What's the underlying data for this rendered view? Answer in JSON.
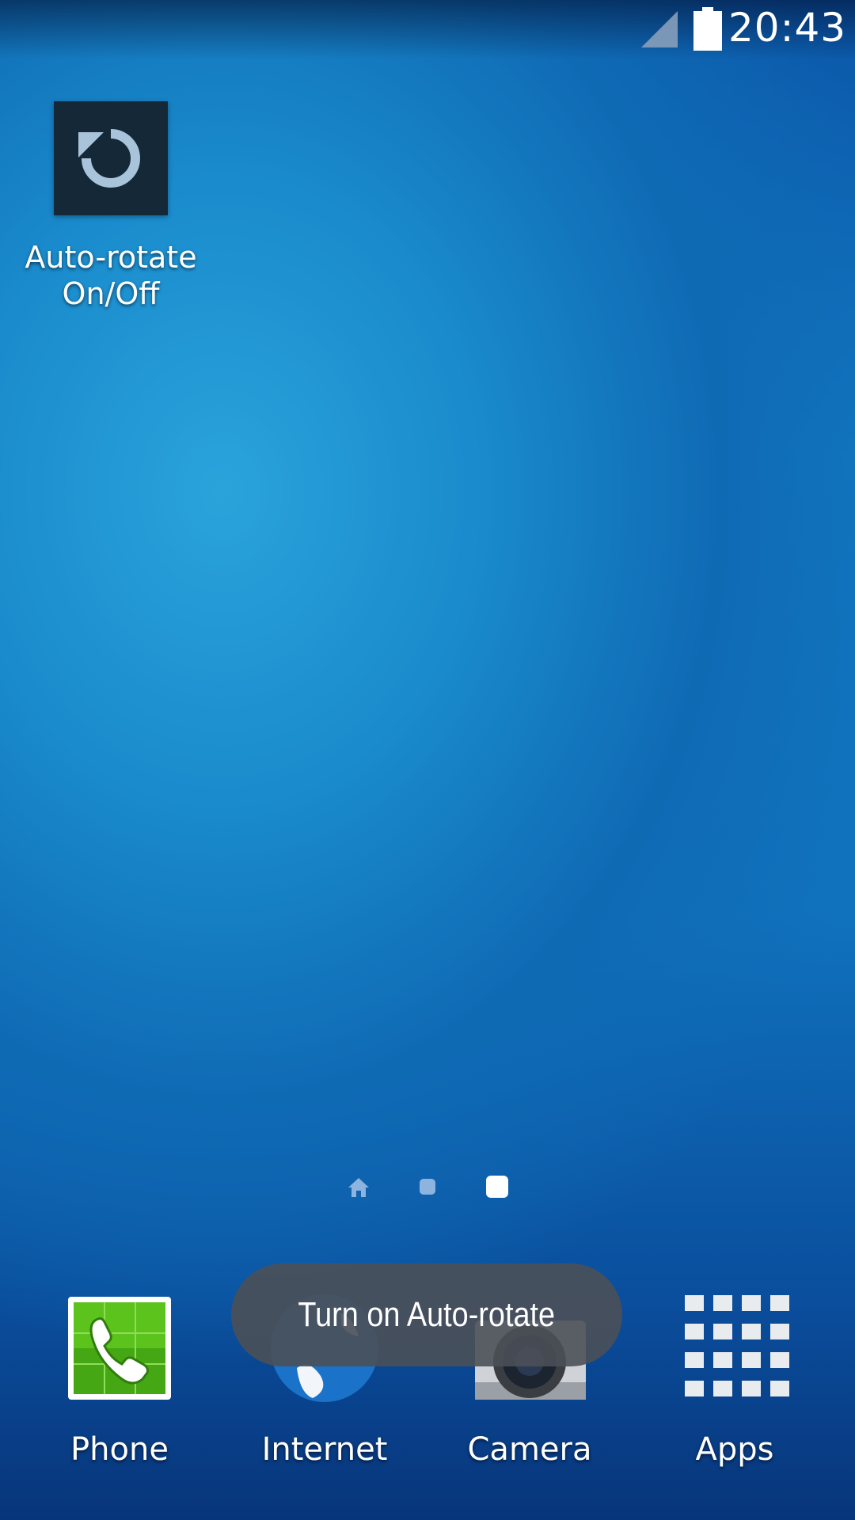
{
  "status_bar": {
    "time": "20:43",
    "signal_icon": "cellular-signal-icon",
    "battery_icon": "battery-full-icon"
  },
  "shortcuts": [
    {
      "label": "Auto-rotate\nOn/Off",
      "icon": "rotate-icon"
    }
  ],
  "page_indicator": {
    "pages": 3,
    "current_page": 3,
    "home_icon": "home-icon"
  },
  "dock": [
    {
      "label": "Phone",
      "icon": "phone-icon"
    },
    {
      "label": "Internet",
      "icon": "globe-icon"
    },
    {
      "label": "Camera",
      "icon": "camera-icon"
    },
    {
      "label": "Apps",
      "icon": "apps-grid-icon"
    }
  ],
  "toast": {
    "text": "Turn on Auto-rotate"
  },
  "colors": {
    "wallpaper_center": "#2aa3db",
    "wallpaper_edge": "#08357a",
    "phone_green": "#5cc21c",
    "toast_bg": "#4b5058"
  }
}
